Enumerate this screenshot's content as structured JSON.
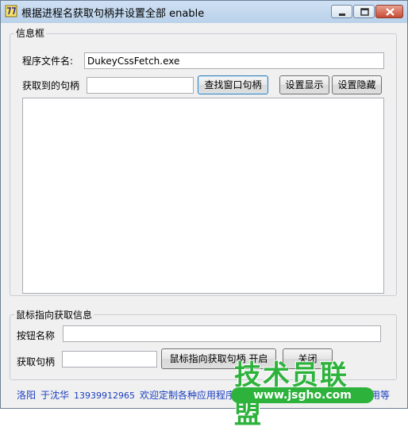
{
  "window": {
    "title": "根据进程名获取句柄并设置全部 enable",
    "icon": "app-icon"
  },
  "info_group": {
    "title": "信息框",
    "program_label": "程序文件名:",
    "program_value": "DukeyCssFetch.exe",
    "handle_label": "获取到的句柄",
    "handle_value": "",
    "find_button": "查找窗口句柄",
    "show_button": "设置显示",
    "hide_button": "设置隐藏",
    "output_text": ""
  },
  "mouse_group": {
    "title": "鼠标指向获取信息",
    "button_name_label": "按钮名称",
    "button_name_value": "",
    "handle_label": "获取句柄",
    "handle_value": "",
    "toggle_button": "鼠标指向获取句柄 开启",
    "close_button": "关闭"
  },
  "footer": {
    "city": "洛阳",
    "name": "于沈华",
    "phone": "13939912965",
    "note": "欢迎定制各种应用程序",
    "tail": "用等"
  },
  "watermark": {
    "logo_text": "技术员联盟",
    "url": "www.jsgho.com"
  },
  "colors": {
    "footer_text": "#1a3ec1",
    "watermark_green": "#2db23c"
  }
}
